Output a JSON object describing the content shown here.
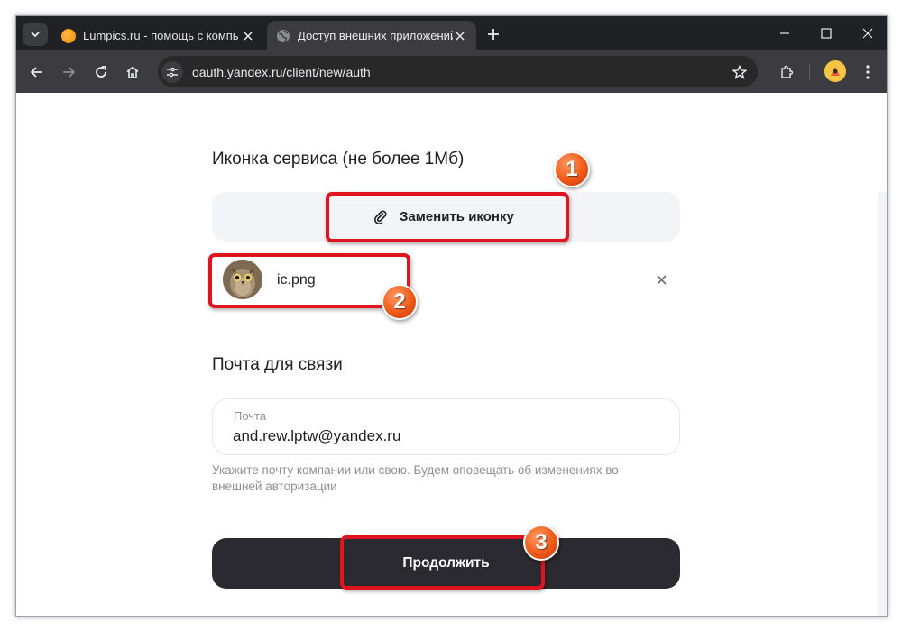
{
  "browser": {
    "tabs": [
      {
        "title": "Lumpics.ru - помощь с компь",
        "active": false,
        "favicon": "orange-circle-icon"
      },
      {
        "title": "Доступ внешних приложений",
        "active": true,
        "favicon": "globe-icon"
      }
    ],
    "address": "oauth.yandex.ru/client/new/auth"
  },
  "form": {
    "icon_section_title": "Иконка сервиса (не более 1Мб)",
    "replace_icon_label": "Заменить иконку",
    "file_name": "ic.png",
    "email_section_title": "Почта для связи",
    "email_label": "Почта",
    "email_value": "and.rew.lptw@yandex.ru",
    "email_hint": "Укажите почту компании или свою. Будем оповещать об изменениях во внешней авторизации",
    "continue_label": "Продолжить"
  },
  "annotations": {
    "markers": [
      "1",
      "2",
      "3"
    ],
    "highlight_color": "#e0141e",
    "marker_color": "#f05a18"
  },
  "colors": {
    "tabstrip_bg": "#202124",
    "toolbar_bg": "#3c3c40",
    "primary_button": "#2a2a30",
    "upload_area_bg": "#f3f4f7"
  }
}
